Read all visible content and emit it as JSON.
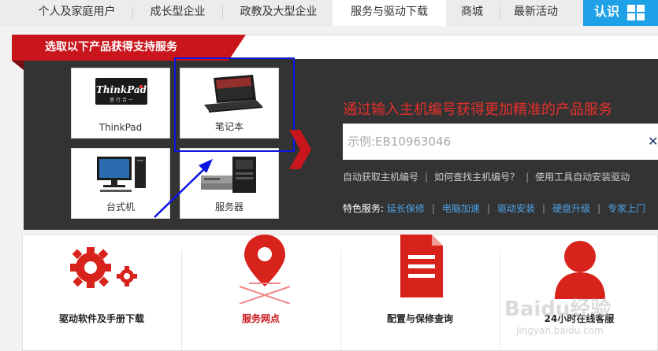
{
  "nav": {
    "items": [
      "个人及家庭用户",
      "成长型企业",
      "政教及大型企业",
      "服务与驱动下载",
      "商城",
      "最新活动"
    ],
    "renzheng": "认识"
  },
  "support": {
    "tab_title": "选取以下产品获得支持服务",
    "products": [
      {
        "label": "ThinkPad",
        "icon": "thinkpad-logo-icon"
      },
      {
        "label": "笔记本",
        "icon": "laptop-icon"
      },
      {
        "label": "台式机",
        "icon": "desktop-icon"
      },
      {
        "label": "服务器",
        "icon": "server-icon"
      }
    ],
    "thinkpad_logo_text": "ThinkPad",
    "thinkpad_logo_sub": "思 行 合 一",
    "heading": "通过输入主机编号获得更加精准的产品服务",
    "search_placeholder": "示例:EB10963046",
    "links": [
      "自动获取主机编号",
      "如何查找主机编号？",
      "使用工具自动安装驱动"
    ],
    "feature_label": "特色服务:",
    "features": [
      "延长保修",
      "电脑加速",
      "驱动安装",
      "硬盘升级",
      "专家上门"
    ]
  },
  "services": [
    {
      "label": "驱动软件及手册下载",
      "icon": "gears-icon",
      "active": false
    },
    {
      "label": "服务网点",
      "icon": "map-pin-icon",
      "active": true
    },
    {
      "label": "配置与保修查询",
      "icon": "document-icon",
      "active": false
    },
    {
      "label": "24小时在线客服",
      "icon": "user-icon",
      "active": false
    }
  ],
  "watermark": {
    "main": "Baidu经验",
    "sub": "jingyan.baidu.com"
  },
  "colors": {
    "brand_red": "#c9161d",
    "accent_blue": "#1ea1e6",
    "panel_dark": "#333333",
    "link_blue": "#4ea3e8"
  }
}
